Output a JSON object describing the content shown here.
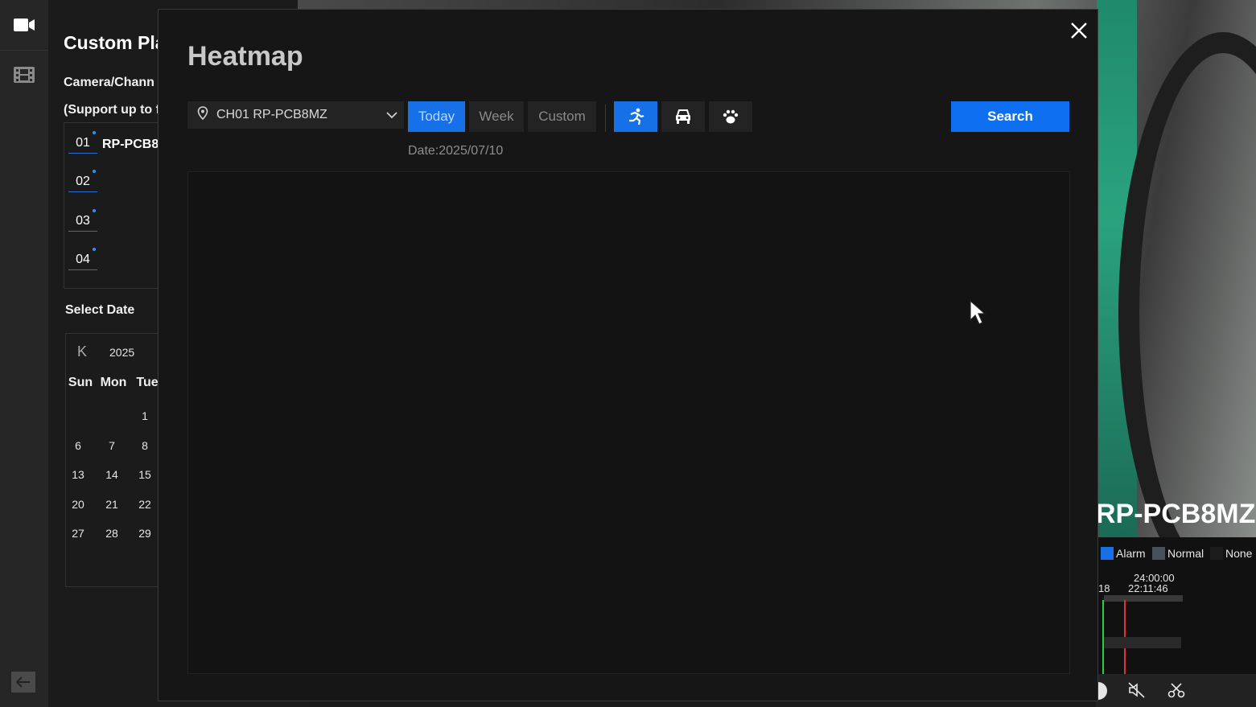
{
  "rail": {
    "icons": [
      "video-camera-icon",
      "film-icon",
      "back-arrow-icon"
    ]
  },
  "background_panel": {
    "title": "Custom Pla",
    "camera_label": "Camera/Chann",
    "support_label": "(Support up to f",
    "channels": [
      {
        "num": "01",
        "name": "RP-PCB8"
      },
      {
        "num": "02",
        "name": ""
      },
      {
        "num": "03",
        "name": ""
      },
      {
        "num": "04",
        "name": ""
      }
    ],
    "select_date_label": "Select Date",
    "calendar": {
      "prev_symbol": "K",
      "year": "2025",
      "weekdays": [
        "Sun",
        "Mon",
        "Tue"
      ],
      "rows": [
        [
          "",
          "",
          "1"
        ],
        [
          "6",
          "7",
          "8"
        ],
        [
          "13",
          "14",
          "15"
        ],
        [
          "20",
          "21",
          "22"
        ],
        [
          "27",
          "28",
          "29"
        ]
      ]
    }
  },
  "preview": {
    "camera_name": "RP-PCB8MZ",
    "legend": [
      {
        "label": "Alarm",
        "color": "#1670e8"
      },
      {
        "label": "Normal",
        "color": "#4a4f5a"
      },
      {
        "label": "None",
        "color": "#1c1c1c"
      }
    ],
    "time_end": "24:00:00",
    "time_current": "22:11:46",
    "time_left": "18"
  },
  "modal": {
    "title": "Heatmap",
    "channel_select": "CH01 RP-PCB8MZ",
    "range_tabs": [
      {
        "label": "Today",
        "active": true
      },
      {
        "label": "Week",
        "active": false
      },
      {
        "label": "Custom",
        "active": false
      }
    ],
    "target_types": [
      {
        "icon": "person-running-icon",
        "active": true
      },
      {
        "icon": "car-icon",
        "active": false
      },
      {
        "icon": "paw-icon",
        "active": false
      }
    ],
    "search_label": "Search",
    "date_text": "Date:2025/07/10",
    "accent": "#1670e8"
  }
}
